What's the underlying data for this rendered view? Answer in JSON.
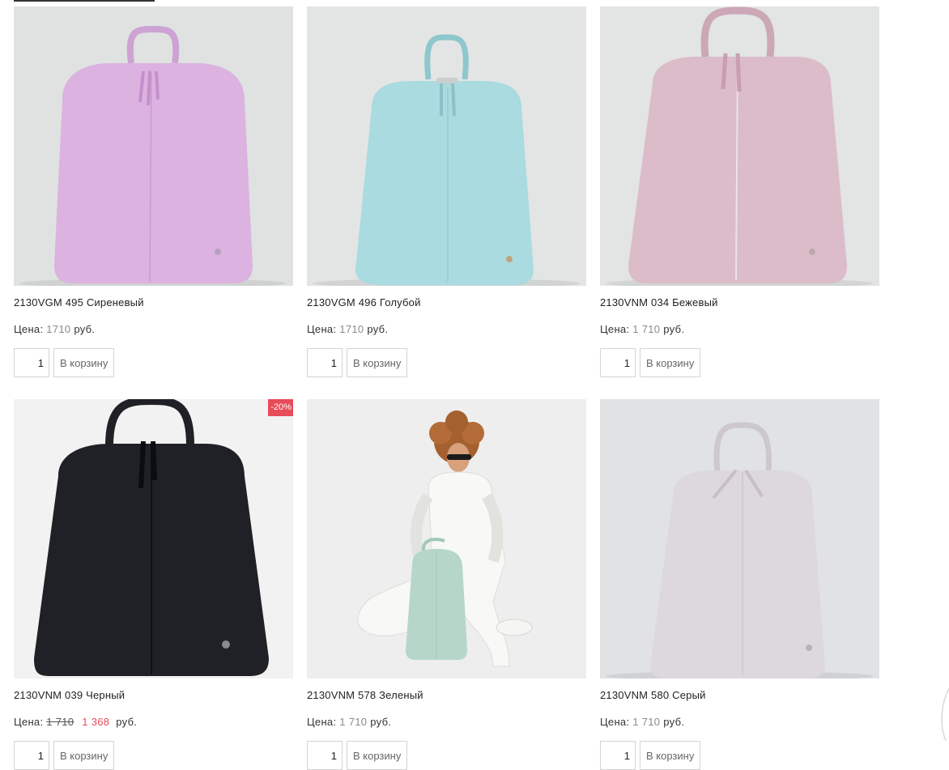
{
  "products": [
    {
      "title": "2130VGM 495 Сиреневый",
      "price_label": "Цена:",
      "price": "1710",
      "currency": "руб.",
      "qty": "1",
      "cart_label": "В корзину",
      "bag_color": "#dcb2e0",
      "bg_color": "#dfe2e1"
    },
    {
      "title": "2130VGM 496 Голубой",
      "price_label": "Цена:",
      "price": "1710",
      "currency": "руб.",
      "qty": "1",
      "cart_label": "В корзину",
      "bag_color": "#a9dbe0",
      "bg_color": "#e3e5e4"
    },
    {
      "title": "2130VNM 034 Бежевый",
      "price_label": "Цена:",
      "price": "1 710",
      "currency": "руб.",
      "qty": "1",
      "cart_label": "В корзину",
      "bag_color": "#dbbcc8",
      "bg_color": "#e3e4e4"
    },
    {
      "title": "2130VNM 039 Черный",
      "price_label": "Цена:",
      "old_price": "1 710",
      "new_price": "1 368",
      "currency": "руб.",
      "badge": "-20%",
      "qty": "1",
      "cart_label": "В корзину",
      "bag_color": "#1f2126",
      "bg_color": "#f2f2f2"
    },
    {
      "title": "2130VNM 578 Зеленый",
      "price_label": "Цена:",
      "price": "1 710",
      "currency": "руб.",
      "qty": "1",
      "cart_label": "В корзину",
      "bag_color": "#b6d6c9",
      "bg_color": "#eeeeee"
    },
    {
      "title": "2130VNM 580 Серый",
      "price_label": "Цена:",
      "price": "1 710",
      "currency": "руб.",
      "qty": "1",
      "cart_label": "В корзину",
      "bag_color": "#ddd8dc",
      "bg_color": "#e0e2e3"
    }
  ]
}
